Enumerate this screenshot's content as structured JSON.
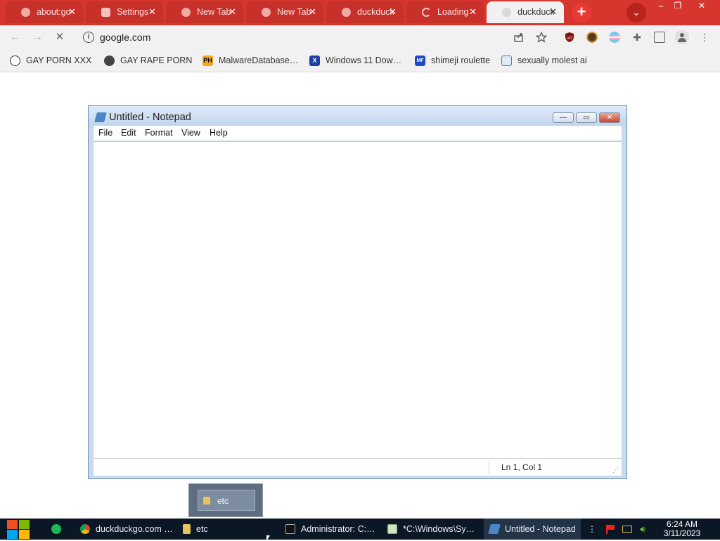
{
  "browser": {
    "tabs": [
      {
        "title": "about:go",
        "close": "✕"
      },
      {
        "title": "Settings",
        "close": "✕"
      },
      {
        "title": "New Tab",
        "close": "✕"
      },
      {
        "title": "New Tab",
        "close": "✕"
      },
      {
        "title": "duckduck",
        "close": "✕"
      },
      {
        "title": "Loading",
        "close": "✕"
      },
      {
        "title": "duckduck",
        "close": "✕"
      }
    ],
    "new_tab": "+",
    "tab_search": "⌄",
    "window_controls": {
      "minimize": "–",
      "restore": "❐",
      "close": "✕"
    },
    "url": "google.com",
    "bookmarks": [
      {
        "label": "GAY PORN XXX",
        "icon": "bookmark-icon-1"
      },
      {
        "label": "GAY RAPE PORN",
        "icon": "globe-icon"
      },
      {
        "label": "MalwareDatabase…",
        "icon": "ph-icon",
        "icon_text": "PH"
      },
      {
        "label": "Windows 11 Dow…",
        "icon": "x-icon",
        "icon_text": "X"
      },
      {
        "label": "shimeji roulette",
        "icon": "mft-icon",
        "icon_text": "MF"
      },
      {
        "label": "sexually molest ai",
        "icon": "ai-icon"
      }
    ]
  },
  "notepad": {
    "title": "Untitled - Notepad",
    "menu": [
      "File",
      "Edit",
      "Format",
      "View",
      "Help"
    ],
    "content": "",
    "status": "Ln 1, Col 1",
    "buttons": {
      "minimize": "—",
      "maximize": "▭",
      "close": "✕"
    }
  },
  "thumbnail": {
    "label": "etc"
  },
  "taskbar": {
    "items": [
      {
        "label": "duckduckgo.com …",
        "icon": "chrome-icon"
      },
      {
        "label": "etc",
        "icon": "folder-icon"
      },
      {
        "label": "Administrator: C:…",
        "icon": "cmd-icon"
      },
      {
        "label": "*C:\\Windows\\Sy…",
        "icon": "notepad-icon"
      },
      {
        "label": "Untitled - Notepad",
        "icon": "notepad-icon"
      }
    ],
    "tray_overflow": "⋮",
    "clock_time": "6:24 AM",
    "clock_date": "3/11/2023"
  }
}
